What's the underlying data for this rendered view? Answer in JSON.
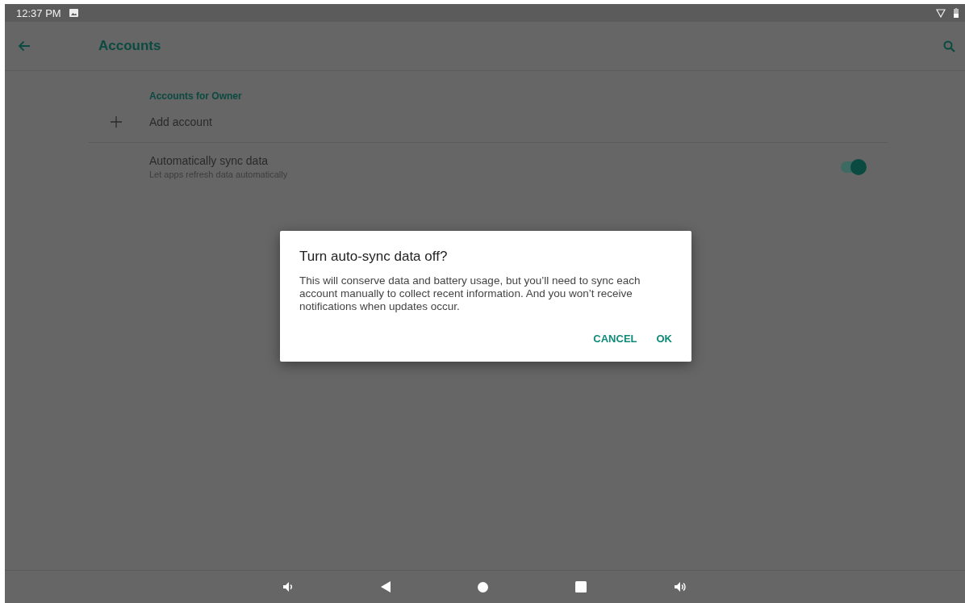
{
  "status_bar": {
    "time": "12:37 PM"
  },
  "app_bar": {
    "title": "Accounts"
  },
  "section": {
    "header": "Accounts for Owner"
  },
  "add_account": {
    "label": "Add account"
  },
  "auto_sync": {
    "title": "Automatically sync data",
    "summary": "Let apps refresh data automatically",
    "on": true
  },
  "dialog": {
    "title": "Turn auto-sync data off?",
    "message": "This will conserve data and battery usage, but you’ll need to sync each account manually to collect recent information. And you won’t receive notifications when updates occur.",
    "buttons": [
      "CANCEL",
      "OK"
    ]
  }
}
